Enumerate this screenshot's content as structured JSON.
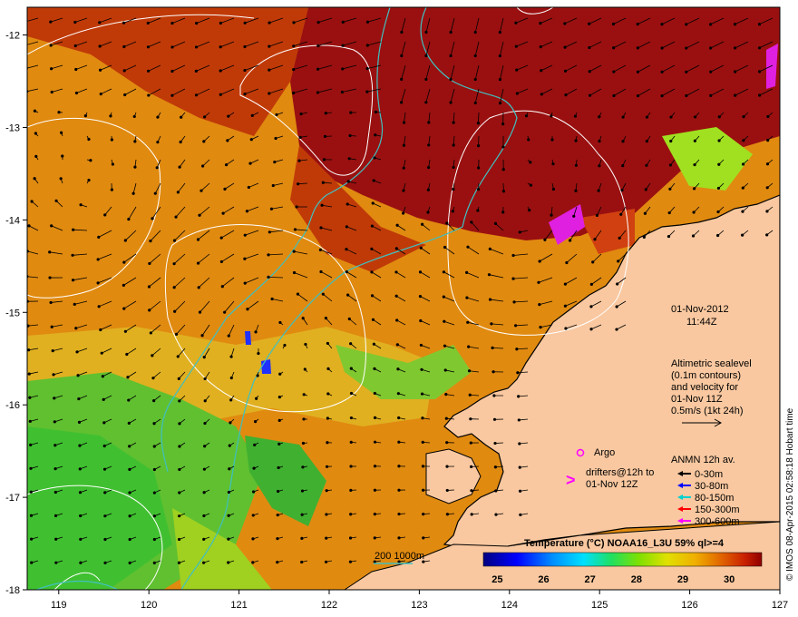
{
  "map": {
    "lon_ticks": [
      "119",
      "120",
      "121",
      "122",
      "123",
      "124",
      "125",
      "126",
      "127"
    ],
    "lat_ticks": [
      "-12",
      "-13",
      "-14",
      "-15",
      "-16",
      "-17",
      "-18"
    ],
    "lon_range": [
      118.65,
      127.0
    ],
    "lat_range": [
      -18.0,
      -11.7
    ],
    "date": "01-Nov-2012",
    "time": "11:44Z",
    "altimetry_note": [
      "Altimetric sealevel",
      "(0.1m contours)",
      "and velocity for",
      "01-Nov 11Z"
    ],
    "velocity_scale_label": "0.5m/s (1kt 24h)",
    "argo_label": "Argo",
    "drifter_symbol": ">",
    "drifter_label": [
      "drifters@12h to",
      "01-Nov 12Z"
    ],
    "anmn_title": "ANMN 12h av.",
    "anmn_legend": [
      {
        "label": "0-30m",
        "color": "#000000"
      },
      {
        "label": "30-80m",
        "color": "#0000ff"
      },
      {
        "label": "80-150m",
        "color": "#00d0d0"
      },
      {
        "label": "150-300m",
        "color": "#ff0000"
      },
      {
        "label": "300-600m",
        "color": "#ff00ff"
      }
    ],
    "isobath_label": "200  1000m",
    "colorbar_title": "Temperature (°C) NOAA16_L3U 59% ql>=4",
    "colorbar_ticks": [
      "25",
      "26",
      "27",
      "28",
      "29",
      "30"
    ],
    "colorbar_range": [
      24.7,
      30.7
    ],
    "credit": "© IMOS 08-Apr-2015 02:58:18 Hobart time",
    "colors": {
      "land": "#f9c8a0",
      "coast": "#000000",
      "isobath": "#40c0c0",
      "contour": "#ffffff",
      "argo": "#ff00ff",
      "drifter": "#ff00ff"
    }
  }
}
